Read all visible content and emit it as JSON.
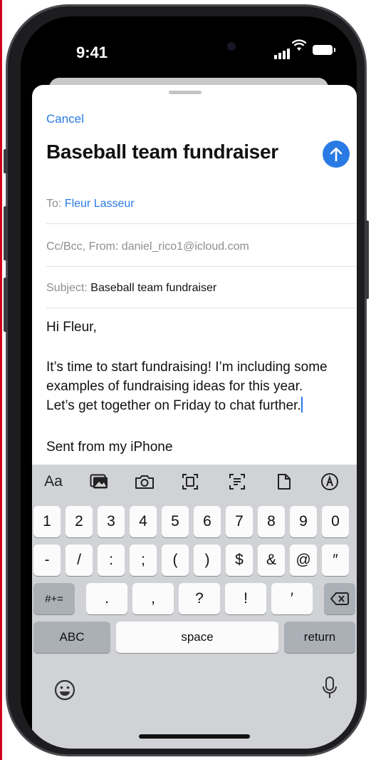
{
  "status": {
    "time": "9:41"
  },
  "compose": {
    "cancel_label": "Cancel",
    "title": "Baseball team fundraiser",
    "to_label": "To:",
    "to_value": "Fleur Lasseur",
    "ccbcc_label": "Cc/Bcc, From:",
    "from_value": "daniel_rico1@icloud.com",
    "subject_label": "Subject:",
    "subject_value": "Baseball team fundraiser",
    "greeting": "Hi Fleur,",
    "body_line1": "It’s time to start fundraising! I’m including some",
    "body_line2": "examples of fundraising ideas for this year.",
    "body_line3": "Let’s get together on Friday to chat further.",
    "signature": "Sent from my iPhone"
  },
  "keyboard": {
    "toolbar": {
      "format_label": "Aa"
    },
    "row1": [
      "1",
      "2",
      "3",
      "4",
      "5",
      "6",
      "7",
      "8",
      "9",
      "0"
    ],
    "row2": [
      "-",
      "/",
      ":",
      ";",
      "(",
      ")",
      "$",
      "&",
      "@",
      "″"
    ],
    "row3": {
      "shift": "#+=",
      "keys": [
        ".",
        ",",
        "?",
        "!",
        "′"
      ]
    },
    "row4": {
      "abc": "ABC",
      "space": "space",
      "return": "return"
    }
  },
  "icons": {
    "send": "arrow-up-icon",
    "toolbar": [
      "photo-library-icon",
      "camera-icon",
      "scan-document-icon",
      "scan-text-icon",
      "attach-file-icon",
      "markup-icon"
    ],
    "delete": "delete-backward-icon",
    "emoji": "emoji-icon",
    "dictation": "microphone-icon"
  },
  "colors": {
    "accent": "#2a7ae4",
    "keyboard_bg": "#d0d2d6"
  }
}
